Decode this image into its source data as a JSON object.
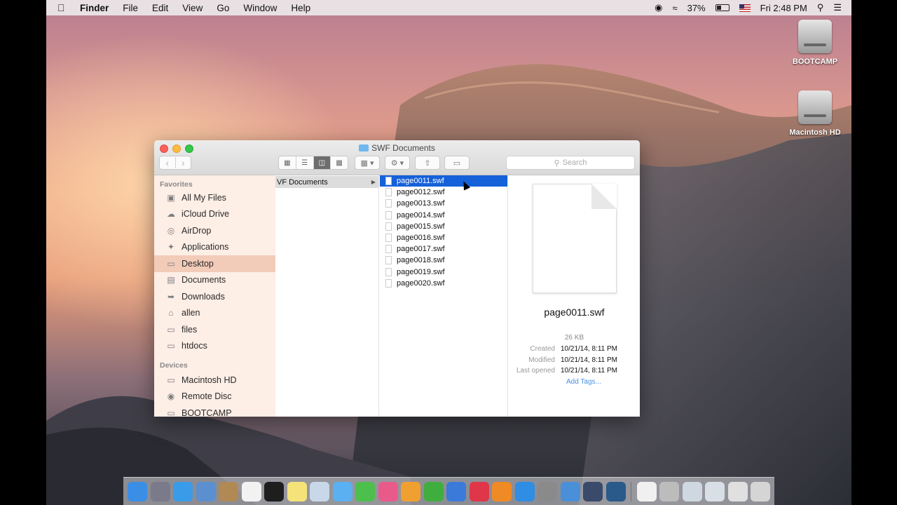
{
  "menubar": {
    "apple_icon": "apple-logo",
    "app_name": "Finder",
    "menus": [
      "File",
      "Edit",
      "View",
      "Go",
      "Window",
      "Help"
    ],
    "battery_pct": "37%",
    "clock": "Fri 2:48 PM"
  },
  "desktop_icons": [
    {
      "label": "BOOTCAMP",
      "icon": "hard-drive-icon"
    },
    {
      "label": "Macintosh HD",
      "icon": "hard-drive-icon"
    }
  ],
  "window": {
    "title": "SWF Documents",
    "search_placeholder": "Search",
    "active_view": "column"
  },
  "sidebar": {
    "favorites_header": "Favorites",
    "favorites": [
      {
        "label": "All My Files",
        "icon": "all-files-icon"
      },
      {
        "label": "iCloud Drive",
        "icon": "cloud-icon"
      },
      {
        "label": "AirDrop",
        "icon": "airdrop-icon"
      },
      {
        "label": "Applications",
        "icon": "applications-icon"
      },
      {
        "label": "Desktop",
        "icon": "desktop-icon",
        "selected": true
      },
      {
        "label": "Documents",
        "icon": "documents-icon"
      },
      {
        "label": "Downloads",
        "icon": "downloads-icon"
      },
      {
        "label": "allen",
        "icon": "home-icon"
      },
      {
        "label": "files",
        "icon": "folder-icon"
      },
      {
        "label": "htdocs",
        "icon": "folder-icon"
      }
    ],
    "devices_header": "Devices",
    "devices": [
      {
        "label": "Macintosh HD",
        "icon": "disk-icon"
      },
      {
        "label": "Remote Disc",
        "icon": "optical-disc-icon"
      },
      {
        "label": "BOOTCAMP",
        "icon": "disk-icon"
      }
    ]
  },
  "column1": {
    "items": [
      {
        "label": "VF Documents",
        "selected": true
      }
    ]
  },
  "column2": {
    "files": [
      {
        "name": "page0011.swf",
        "selected": true
      },
      {
        "name": "page0012.swf"
      },
      {
        "name": "page0013.swf"
      },
      {
        "name": "page0014.swf"
      },
      {
        "name": "page0015.swf"
      },
      {
        "name": "page0016.swf"
      },
      {
        "name": "page0017.swf"
      },
      {
        "name": "page0018.swf"
      },
      {
        "name": "page0019.swf"
      },
      {
        "name": "page0020.swf"
      }
    ]
  },
  "preview": {
    "filename": "page0011.swf",
    "size": "26 KB",
    "created_label": "Created",
    "created": "10/21/14, 8:11 PM",
    "modified_label": "Modified",
    "modified": "10/21/14, 8:11 PM",
    "last_opened_label": "Last opened",
    "last_opened": "10/21/14, 8:11 PM",
    "add_tags": "Add Tags..."
  },
  "dock": {
    "apps": [
      {
        "name": "finder-icon",
        "color": "#3a8ee6"
      },
      {
        "name": "launchpad-icon",
        "color": "#7a7a8a"
      },
      {
        "name": "safari-icon",
        "color": "#3a9be8"
      },
      {
        "name": "mail-icon",
        "color": "#5b8fd0"
      },
      {
        "name": "contacts-icon",
        "color": "#b08955"
      },
      {
        "name": "calendar-icon",
        "color": "#f2f2f2"
      },
      {
        "name": "terminal-icon",
        "color": "#1e1e1e"
      },
      {
        "name": "notes-icon",
        "color": "#f5e37a"
      },
      {
        "name": "preview-icon",
        "color": "#c9d8e8"
      },
      {
        "name": "messages-icon",
        "color": "#5ab0f0"
      },
      {
        "name": "facetime-icon",
        "color": "#4cbf4c"
      },
      {
        "name": "photos-icon",
        "color": "#e85a8a"
      },
      {
        "name": "pages-icon",
        "color": "#f0a030"
      },
      {
        "name": "numbers-icon",
        "color": "#3fae3f"
      },
      {
        "name": "keynote-icon",
        "color": "#3b7ad8"
      },
      {
        "name": "itunes-icon",
        "color": "#e0364a"
      },
      {
        "name": "ibooks-icon",
        "color": "#f08a24"
      },
      {
        "name": "app-store-icon",
        "color": "#2f8de4"
      },
      {
        "name": "system-preferences-icon",
        "color": "#8a8a8a"
      },
      {
        "name": "xcode-icon",
        "color": "#4a90d8"
      },
      {
        "name": "dashboard-icon",
        "color": "#3a4a6a"
      },
      {
        "name": "quicktime-icon",
        "color": "#2a5a8a"
      }
    ],
    "right_items": [
      {
        "name": "document-icon",
        "color": "#f0f0f0"
      },
      {
        "name": "screenshot-icon",
        "color": "#bcbcbc"
      },
      {
        "name": "screenshot-icon",
        "color": "#cfd8e0"
      },
      {
        "name": "screenshot-icon",
        "color": "#d8dfe6"
      },
      {
        "name": "screenshot-icon",
        "color": "#e0e0e0"
      },
      {
        "name": "trash-icon",
        "color": "#d5d5d5"
      }
    ]
  }
}
